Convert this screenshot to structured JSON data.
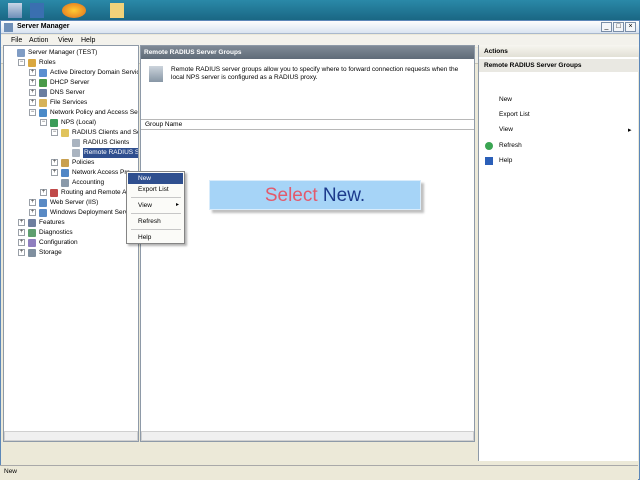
{
  "window": {
    "title": "Server Manager"
  },
  "menu": [
    "File",
    "Action",
    "View",
    "Help"
  ],
  "tree": [
    {
      "label": "Server Manager (TEST)",
      "level": 0
    },
    {
      "label": "Roles",
      "level": 1
    },
    {
      "label": "Active Directory Domain Servic",
      "level": 2
    },
    {
      "label": "DHCP Server",
      "level": 2
    },
    {
      "label": "DNS Server",
      "level": 2
    },
    {
      "label": "File Services",
      "level": 2
    },
    {
      "label": "Network Policy and Access Serv",
      "level": 2
    },
    {
      "label": "NPS (Local)",
      "level": 3
    },
    {
      "label": "RADIUS Clients and Ser",
      "level": 4
    },
    {
      "label": "RADIUS Clients",
      "level": 5
    },
    {
      "label": "Remote RADIUS Se",
      "level": 5,
      "selected": true
    },
    {
      "label": "Policies",
      "level": 4
    },
    {
      "label": "Network Access Pro",
      "level": 4
    },
    {
      "label": "Accounting",
      "level": 4
    },
    {
      "label": "Routing and Remote Ac",
      "level": 3
    },
    {
      "label": "Web Server (IIS)",
      "level": 2
    },
    {
      "label": "Windows Deployment Servic",
      "level": 2
    },
    {
      "label": "Features",
      "level": 1
    },
    {
      "label": "Diagnostics",
      "level": 1
    },
    {
      "label": "Configuration",
      "level": 1
    },
    {
      "label": "Storage",
      "level": 1
    }
  ],
  "center": {
    "header": "Remote RADIUS Server Groups",
    "description": "Remote RADIUS server groups allow you to specify where to forward connection requests when the local NPS server is configured as a RADIUS proxy.",
    "column": "Group Name"
  },
  "context_menu": {
    "items": [
      "New",
      "Export List",
      "View",
      "Refresh",
      "Help"
    ]
  },
  "callout": {
    "prefix": "Select ",
    "emphasis": "New",
    "suffix": "."
  },
  "actions": {
    "header": "Actions",
    "section": "Remote RADIUS Server Groups",
    "items": [
      "New",
      "Export List",
      "View",
      "Refresh",
      "Help"
    ]
  },
  "status": "New"
}
